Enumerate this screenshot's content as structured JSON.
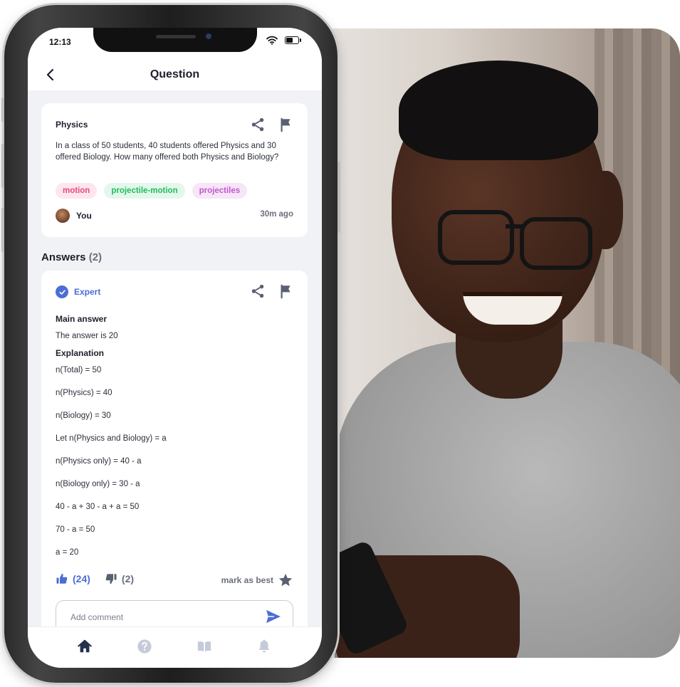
{
  "status": {
    "time": "12:13"
  },
  "appbar": {
    "title": "Question"
  },
  "question": {
    "subject": "Physics",
    "text": "In a class of 50 students, 40 students offered Physics and 30 offered Biology. How many offered both Physics and Biology?",
    "tags": [
      "motion",
      "projectile-motion",
      "projectiles"
    ],
    "author": "You",
    "time_ago": "30m ago"
  },
  "answers": {
    "heading": "Answers",
    "count": "(2)",
    "items": [
      {
        "badge": "Expert",
        "main_heading": "Main answer",
        "main_text": "The answer is 20",
        "explanation_heading": "Explanation",
        "steps": [
          "n(Total) = 50",
          "n(Physics) = 40",
          "n(Biology) = 30",
          "Let n(Physics and Biology) = a",
          "n(Physics only) = 40 - a",
          "n(Biology only) = 30 - a",
          "40 - a + 30 - a + a = 50",
          "70 - a = 50",
          "a = 20"
        ],
        "upvotes": "(24)",
        "downvotes": "(2)",
        "mark_best": "mark as best"
      }
    ]
  },
  "comment": {
    "placeholder": "Add comment"
  },
  "tabs": [
    "home-icon",
    "help-icon",
    "book-icon",
    "bell-icon"
  ],
  "colors": {
    "accent": "#4b6ed4",
    "background": "#f1f2f5",
    "text": "#1d1f2c",
    "muted": "#6b6f7d"
  }
}
